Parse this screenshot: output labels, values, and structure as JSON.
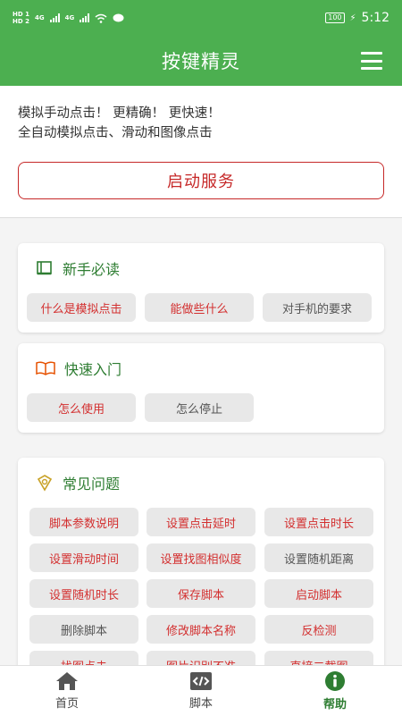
{
  "status_bar": {
    "left": {
      "hd_top": "HD 1",
      "hd_bottom": "HD 2",
      "net1": "4G",
      "net2": "4G"
    },
    "battery": "100",
    "time": "5:12"
  },
  "header": {
    "title": "按键精灵",
    "menu_icon": "hamburger-menu-icon"
  },
  "intro": {
    "line1": "模拟手动点击！ 更精确！ 更快速！",
    "line2": "全自动模拟点击、滑动和图像点击"
  },
  "start_button": "启动服务",
  "sections": [
    {
      "title": "新手必读",
      "icon": "book-icon",
      "items": [
        {
          "label": "什么是模拟点击",
          "color": "red"
        },
        {
          "label": "能做些什么",
          "color": "red"
        },
        {
          "label": "对手机的要求",
          "color": "gray"
        }
      ]
    },
    {
      "title": "快速入门",
      "icon": "open-book-icon",
      "items": [
        {
          "label": "怎么使用",
          "color": "red"
        },
        {
          "label": "怎么停止",
          "color": "gray"
        }
      ]
    },
    {
      "title": "常见问题",
      "icon": "question-shield-icon",
      "items": [
        {
          "label": "脚本参数说明",
          "color": "red"
        },
        {
          "label": "设置点击延时",
          "color": "red"
        },
        {
          "label": "设置点击时长",
          "color": "red"
        },
        {
          "label": "设置滑动时间",
          "color": "red"
        },
        {
          "label": "设置找图相似度",
          "color": "red"
        },
        {
          "label": "设置随机距离",
          "color": "gray"
        },
        {
          "label": "设置随机时长",
          "color": "red"
        },
        {
          "label": "保存脚本",
          "color": "red"
        },
        {
          "label": "启动脚本",
          "color": "red"
        },
        {
          "label": "删除脚本",
          "color": "gray"
        },
        {
          "label": "修改脚本名称",
          "color": "red"
        },
        {
          "label": "反检测",
          "color": "red"
        },
        {
          "label": "找图点击",
          "color": "red"
        },
        {
          "label": "图片识别不准",
          "color": "red"
        },
        {
          "label": "直接二截图",
          "color": "red"
        }
      ]
    }
  ],
  "bottom_nav": [
    {
      "label": "首页",
      "icon": "home-icon",
      "active": false
    },
    {
      "label": "脚本",
      "icon": "code-icon",
      "active": false
    },
    {
      "label": "帮助",
      "icon": "info-icon",
      "active": true
    }
  ],
  "colors": {
    "primary": "#4caf50",
    "accent_red": "#d32f2f",
    "title_green": "#2e7d32"
  }
}
